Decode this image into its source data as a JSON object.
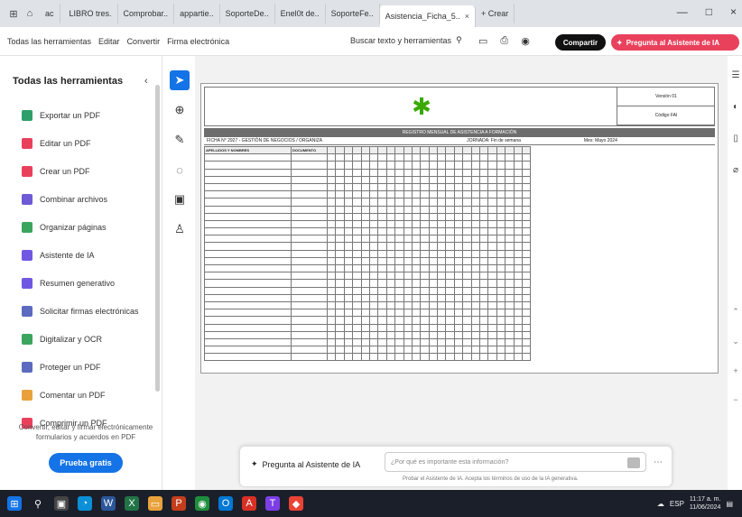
{
  "browser": {
    "tabs": [
      {
        "label": "LIBRO tres.",
        "active": false
      },
      {
        "label": "Comprobar..",
        "active": false
      },
      {
        "label": "appartie..",
        "active": false
      },
      {
        "label": "SoporteDe..",
        "active": false
      },
      {
        "label": "Enel0t de..",
        "active": false
      },
      {
        "label": "SoporteFe..",
        "active": false
      },
      {
        "label": "Asistencia_Ficha_5..",
        "active": true
      },
      {
        "label": "+ Crear",
        "active": false
      }
    ],
    "short_tab": "ac",
    "active_tab_close": "×",
    "window_controls": [
      "—",
      "□",
      "×"
    ]
  },
  "menubar": {
    "items": [
      "Todas las herramientas",
      "Editar",
      "Convertir",
      "Firma electrónica"
    ],
    "search_label": "Buscar texto y herramientas",
    "share_label": "Compartir",
    "ai_label": "Pregunta al Asistente de IA"
  },
  "sidebar": {
    "title": "Todas las herramientas",
    "items": [
      {
        "label": "Exportar un PDF",
        "icon": "export-pdf-icon",
        "color": "#2e9f6b"
      },
      {
        "label": "Editar un PDF",
        "icon": "edit-pdf-icon",
        "color": "#e9415c"
      },
      {
        "label": "Crear un PDF",
        "icon": "create-pdf-icon",
        "color": "#e9415c"
      },
      {
        "label": "Combinar archivos",
        "icon": "combine-files-icon",
        "color": "#6e5ad7"
      },
      {
        "label": "Organizar páginas",
        "icon": "organize-pages-icon",
        "color": "#3ba55d"
      },
      {
        "label": "Asistente de IA",
        "icon": "ai-assistant-icon",
        "color": "#7158e2"
      },
      {
        "label": "Resumen generativo",
        "icon": "summary-icon",
        "color": "#7158e2"
      },
      {
        "label": "Solicitar firmas electrónicas",
        "icon": "request-sign-icon",
        "color": "#5c6bc0"
      },
      {
        "label": "Digitalizar y OCR",
        "icon": "scan-ocr-icon",
        "color": "#3ba55d"
      },
      {
        "label": "Proteger un PDF",
        "icon": "protect-pdf-icon",
        "color": "#5c6bc0"
      },
      {
        "label": "Comentar un PDF",
        "icon": "comment-pdf-icon",
        "color": "#e9a23b"
      },
      {
        "label": "Comprimir un PDF",
        "icon": "compress-pdf-icon",
        "color": "#e9415c"
      }
    ],
    "promo_text": "Convertir, editar y firmar electrónicamente formularios y acuerdos en PDF",
    "try_button": "Prueba gratis"
  },
  "document": {
    "title_bar": "REGISTRO MENSUAL DE ASISTENCIA A FORMACIÓN",
    "header_box": [
      "Versión 01",
      "Código FAI"
    ],
    "info": [
      "FICHA N° 2927 - GESTIÓN DE NEGOCIOS / ORGANIZA",
      "JORNADA: Fin de semana",
      "Mes: Mayo 2024"
    ],
    "col_headers": [
      "APELLIDOS Y NOMBRES",
      "DOCUMENTO"
    ],
    "day_count": 24,
    "row_count": 28
  },
  "ai_bar": {
    "label": "Pregunta al Asistente de IA",
    "placeholder": "¿Por qué es importante esta información?",
    "note": "Probar el Asistente de IA. Acepta los términos de uso de la IA generativa."
  },
  "taskbar": {
    "time": "11:17 a. m.",
    "date": "11/06/2024",
    "tray_text": "ESP"
  },
  "colors": {
    "accent": "#1473e6",
    "ai": "#e9415c",
    "sena_green": "#39a900"
  }
}
